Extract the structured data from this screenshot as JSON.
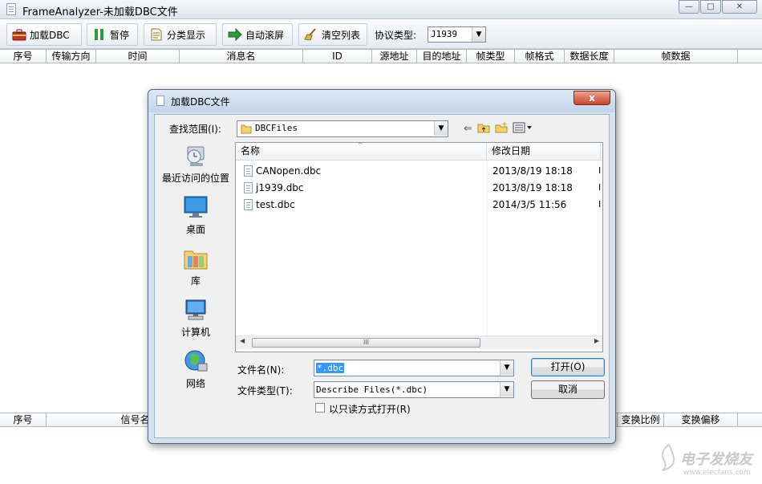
{
  "window": {
    "title": "FrameAnalyzer-未加载DBC文件"
  },
  "toolbar": {
    "load_dbc": "加载DBC",
    "pause": "暂停",
    "categorize": "分类显示",
    "autoscroll": "自动滚屏",
    "clear_list": "清空列表",
    "protocol_label": "协议类型:",
    "protocol_value": "J1939"
  },
  "top_grid": {
    "columns": [
      "序号",
      "传输方向",
      "时间",
      "消息名",
      "ID",
      "源地址",
      "目的地址",
      "帧类型",
      "帧格式",
      "数据长度",
      "帧数据"
    ]
  },
  "bottom_grid": {
    "columns": [
      "序号",
      "信号名",
      "变换比例",
      "变换偏移"
    ]
  },
  "dialog": {
    "title": "加载DBC文件",
    "close": "x",
    "look_in_label": "查找范围(I):",
    "look_in_value": "DBCFiles",
    "places": [
      {
        "label": "最近访问的位置",
        "icon": "recent-places-icon"
      },
      {
        "label": "桌面",
        "icon": "desktop-icon"
      },
      {
        "label": "库",
        "icon": "libraries-icon"
      },
      {
        "label": "计算机",
        "icon": "computer-icon"
      },
      {
        "label": "网络",
        "icon": "network-icon"
      }
    ],
    "columns": {
      "name": "名称",
      "date": "修改日期"
    },
    "files": [
      {
        "name": "CANopen.dbc",
        "date": "2013/8/19 18:18",
        "more": "I"
      },
      {
        "name": "j1939.dbc",
        "date": "2013/8/19 18:18",
        "more": "I"
      },
      {
        "name": "test.dbc",
        "date": "2014/3/5 11:56",
        "more": "I"
      }
    ],
    "filename_label": "文件名(N):",
    "filename_value": "*.dbc",
    "filetype_label": "文件类型(T):",
    "filetype_value": "Describe Files(*.dbc)",
    "readonly_label": "以只读方式打开(R)",
    "open_button": "打开(O)",
    "cancel_button": "取消"
  },
  "watermark": {
    "text": "电子发烧友",
    "url": "www.elecfans.com"
  }
}
